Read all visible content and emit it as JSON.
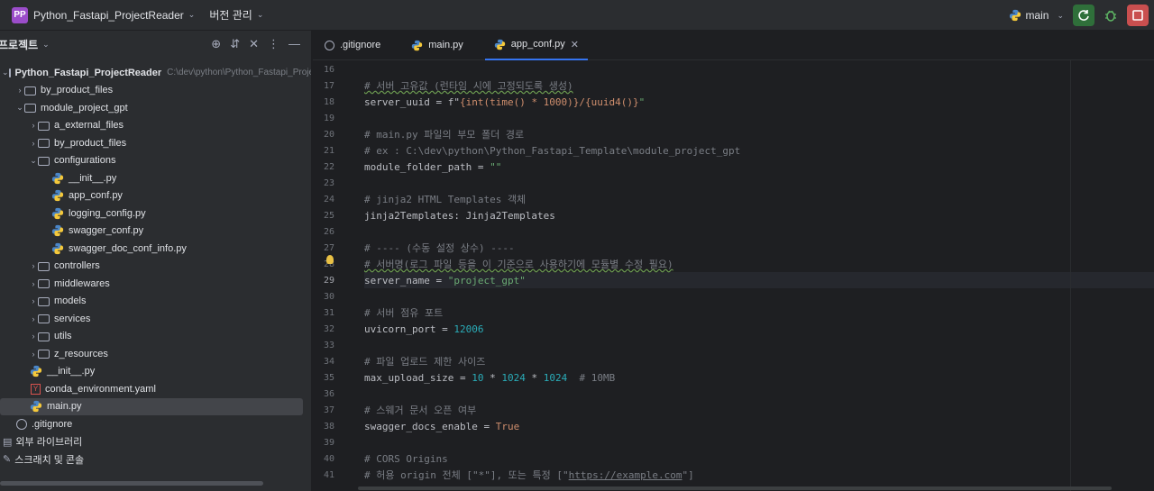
{
  "titlebar": {
    "project_badge": "PP",
    "project_name": "Python_Fastapi_ProjectReader",
    "vcs_menu": "버전 관리",
    "branch": "main"
  },
  "sidebar": {
    "title": "프로젝트",
    "root": {
      "name": "Python_Fastapi_ProjectReader",
      "path": "C:\\dev\\python\\Python_Fastapi_ProjectR"
    },
    "items": [
      {
        "label": "by_product_files"
      },
      {
        "label": "module_project_gpt"
      },
      {
        "label": "a_external_files"
      },
      {
        "label": "by_product_files"
      },
      {
        "label": "configurations"
      },
      {
        "label": "__init__.py"
      },
      {
        "label": "app_conf.py"
      },
      {
        "label": "logging_config.py"
      },
      {
        "label": "swagger_conf.py"
      },
      {
        "label": "swagger_doc_conf_info.py"
      },
      {
        "label": "controllers"
      },
      {
        "label": "middlewares"
      },
      {
        "label": "models"
      },
      {
        "label": "services"
      },
      {
        "label": "utils"
      },
      {
        "label": "z_resources"
      },
      {
        "label": "__init__.py"
      },
      {
        "label": "conda_environment.yaml"
      },
      {
        "label": "main.py"
      },
      {
        "label": ".gitignore"
      },
      {
        "label": "외부 라이브러리"
      },
      {
        "label": "스크래치 및 콘솔"
      }
    ]
  },
  "tabs": [
    {
      "label": ".gitignore"
    },
    {
      "label": "main.py"
    },
    {
      "label": "app_conf.py",
      "active": true
    }
  ],
  "editor": {
    "line_numbers": [
      "16",
      "17",
      "18",
      "19",
      "20",
      "21",
      "22",
      "23",
      "24",
      "25",
      "26",
      "27",
      "28",
      "29",
      "30",
      "31",
      "32",
      "33",
      "34",
      "35",
      "36",
      "37",
      "38",
      "39",
      "40",
      "41"
    ],
    "current_line": "29",
    "code": {
      "l17": "# 서버 고유값 (런타임 시에 고정되도록 생성)",
      "l18_a": "server_uuid = f\"",
      "l18_b": "{int(time() * 1000)}/{uuid4()}",
      "l18_c": "\"",
      "l20": "# main.py 파일의 부모 폴더 경로",
      "l21": "# ex : C:\\dev\\python\\Python_Fastapi_Template\\module_project_gpt",
      "l22_a": "module_folder_path = ",
      "l22_b": "\"\"",
      "l24": "# jinja2 HTML Templates 객체",
      "l25": "jinja2Templates: Jinja2Templates",
      "l27": "# ---- (수동 설정 상수) ----",
      "l28": "# 서버명(로그 파일 등을 이 기준으로 사용하기에 모듈별 수정 필요)",
      "l29_a": "server_name = ",
      "l29_b": "\"project_gpt\"",
      "l31": "# 서버 점유 포트",
      "l32_a": "uvicorn_port = ",
      "l32_b": "12006",
      "l34": "# 파일 업로드 제한 사이즈",
      "l35_a": "max_upload_size = ",
      "l35_b": "10",
      "l35_c": " * ",
      "l35_d": "1024",
      "l35_e": " * ",
      "l35_f": "1024",
      "l35_g": "  # 10MB",
      "l37": "# 스웨거 문서 오픈 여부",
      "l38_a": "swagger_docs_enable = ",
      "l38_b": "True",
      "l40": "# CORS Origins",
      "l41_a": "# 허용 origin 전체 [\"*\"], 또는 특정 [\"",
      "l41_b": "https://example.com",
      "l41_c": "\"]"
    }
  },
  "colors": {
    "accent": "#3574f0",
    "run_button": "#2f6f3a",
    "stop_button": "#c94f4f",
    "project_badge": "#9b4dca"
  }
}
